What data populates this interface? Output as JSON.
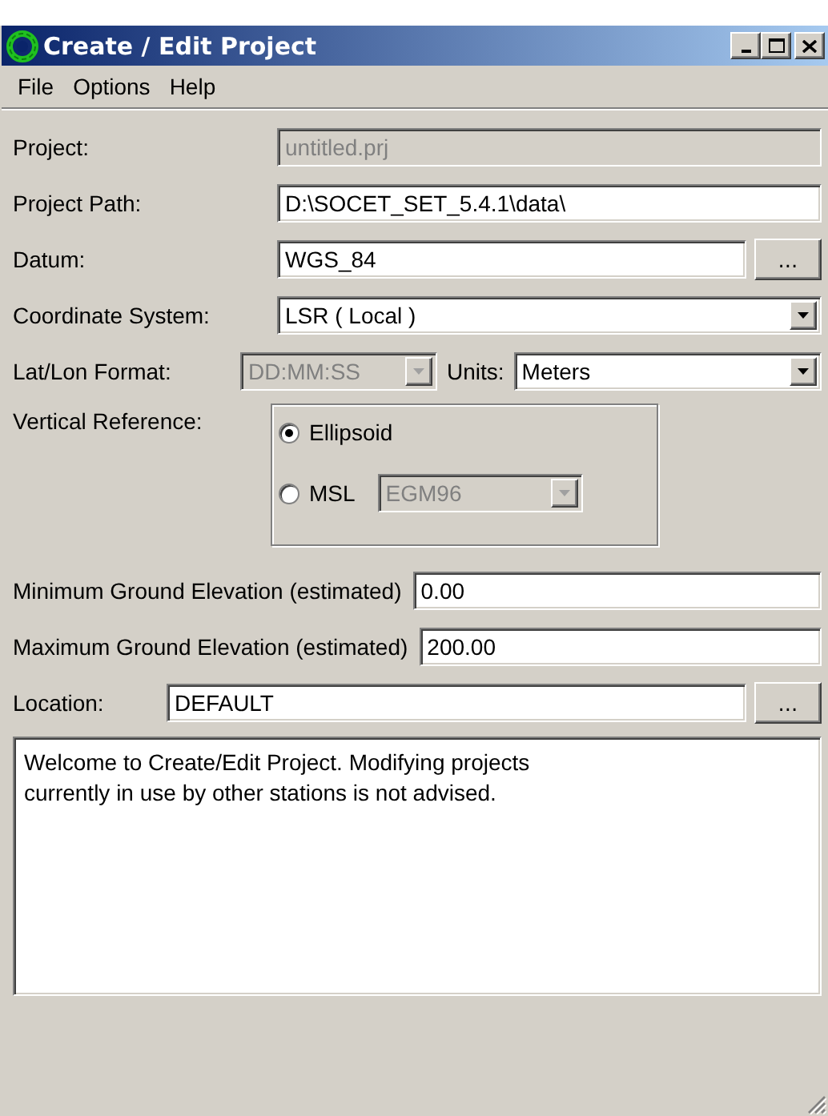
{
  "window": {
    "title": "Create / Edit Project"
  },
  "menu": [
    {
      "label": "File"
    },
    {
      "label": "Options"
    },
    {
      "label": "Help"
    }
  ],
  "project": {
    "label": "Project:",
    "value": "untitled.prj",
    "disabled": true
  },
  "project_path": {
    "label": "Project Path:",
    "value": "D:\\SOCET_SET_5.4.1\\data\\",
    "disabled": false
  },
  "datum": {
    "label": "Datum:",
    "value": "WGS_84",
    "button": "..."
  },
  "coordinate_system": {
    "label": "Coordinate System:",
    "value": "LSR ( Local )",
    "disabled": false
  },
  "lat_lon_format": {
    "label": "Lat/Lon Format:",
    "value": "DD:MM:SS",
    "disabled": true
  },
  "units": {
    "label": "Units:",
    "value": "Meters",
    "disabled": false
  },
  "vertical_reference": {
    "label": "Vertical Reference:",
    "options": [
      {
        "label": "Ellipsoid",
        "selected": true
      },
      {
        "label": "MSL",
        "selected": false,
        "model": {
          "value": "EGM96",
          "disabled": true
        }
      }
    ]
  },
  "elevations": [
    {
      "label": "Minimum Ground Elevation (estimated)",
      "value": "0.00"
    },
    {
      "label": "Maximum Ground Elevation (estimated)",
      "value": "200.00"
    }
  ],
  "location": {
    "label": "Location:",
    "value": "DEFAULT",
    "button": "..."
  },
  "message": "Welcome to Create/Edit Project. Modifying projects currently in use by other stations is not advised."
}
